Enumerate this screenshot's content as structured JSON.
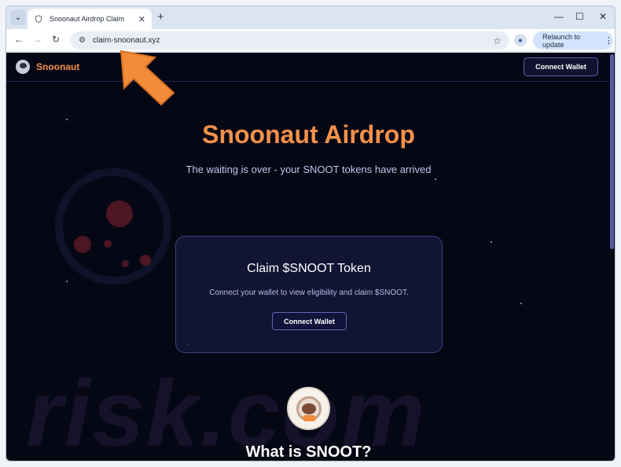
{
  "browser": {
    "tab_title": "Snoonaut Airdrop Claim",
    "url": "claim-snoonaut.xyz",
    "relaunch_label": "Relaunch to update"
  },
  "site": {
    "brand": "Snoonaut",
    "header_button": "Connect Wallet",
    "hero_title": "Snoonaut Airdrop",
    "hero_subtitle": "The waiting is over - your SNOOT tokens have arrived",
    "claim_title": "Claim $SNOOT Token",
    "claim_description": "Connect your wallet to view eligibility and claim $SNOOT.",
    "claim_button": "Connect Wallet",
    "section_title": "What is SNOOT?"
  },
  "watermark": {
    "text": "risk.com"
  },
  "colors": {
    "accent_orange": "#f3914a",
    "page_background": "#060714",
    "card_border": "#3c3f7e",
    "arrow_orange": "#f28c38"
  },
  "icons": {
    "tab_favicon": "shield-icon",
    "site_logo": "astronaut-icon",
    "menu": "kebab-menu-icon",
    "profile": "person-icon"
  }
}
